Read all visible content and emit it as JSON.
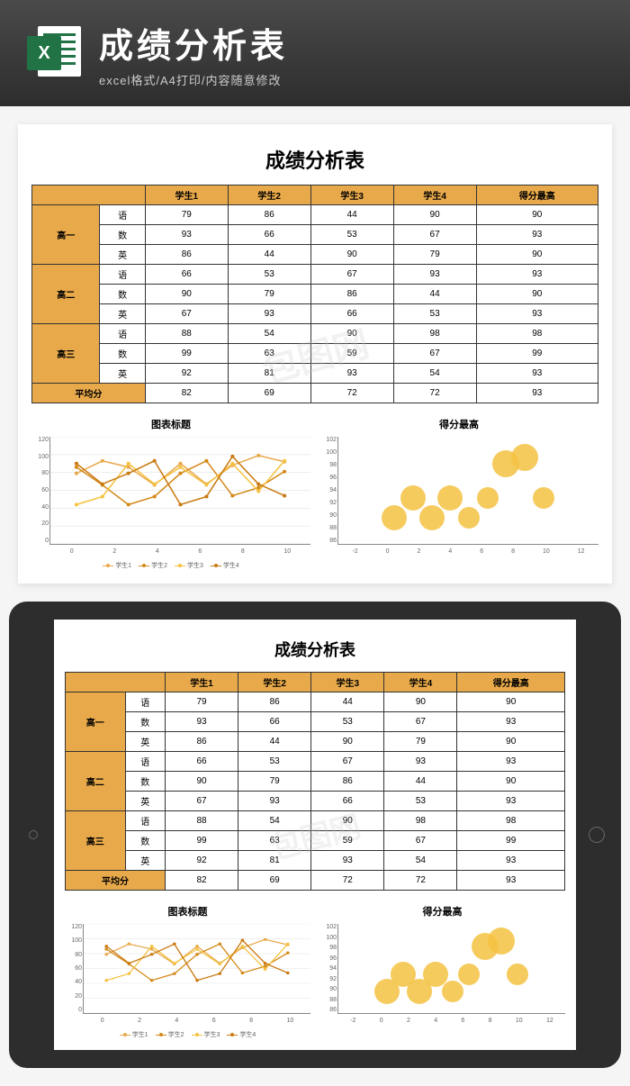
{
  "banner": {
    "title": "成绩分析表",
    "subtitle": "excel格式/A4打印/内容随意修改",
    "icon_letter": "X"
  },
  "doc": {
    "title": "成绩分析表",
    "headers": [
      "",
      "",
      "学生1",
      "学生2",
      "学生3",
      "学生4",
      "得分最高"
    ],
    "grades": [
      "高一",
      "高二",
      "高三"
    ],
    "subjects": [
      "语",
      "数",
      "英"
    ],
    "rows": [
      {
        "grade": 0,
        "subj": 0,
        "vals": [
          79,
          86,
          44,
          90,
          90
        ]
      },
      {
        "grade": 0,
        "subj": 1,
        "vals": [
          93,
          66,
          53,
          67,
          93
        ]
      },
      {
        "grade": 0,
        "subj": 2,
        "vals": [
          86,
          44,
          90,
          79,
          90
        ]
      },
      {
        "grade": 1,
        "subj": 0,
        "vals": [
          66,
          53,
          67,
          93,
          93
        ]
      },
      {
        "grade": 1,
        "subj": 1,
        "vals": [
          90,
          79,
          86,
          44,
          90
        ]
      },
      {
        "grade": 1,
        "subj": 2,
        "vals": [
          67,
          93,
          66,
          53,
          93
        ]
      },
      {
        "grade": 2,
        "subj": 0,
        "vals": [
          88,
          54,
          90,
          98,
          98
        ]
      },
      {
        "grade": 2,
        "subj": 1,
        "vals": [
          99,
          63,
          59,
          67,
          99
        ]
      },
      {
        "grade": 2,
        "subj": 2,
        "vals": [
          92,
          81,
          93,
          54,
          93
        ]
      }
    ],
    "avg_label": "平均分",
    "avg_vals": [
      82,
      69,
      72,
      72,
      93
    ]
  },
  "chart_data": [
    {
      "type": "line",
      "title": "图表标题",
      "x": [
        1,
        2,
        3,
        4,
        5,
        6,
        7,
        8,
        9
      ],
      "series": [
        {
          "name": "学生1",
          "color": "#e8a94a",
          "values": [
            79,
            93,
            86,
            66,
            90,
            67,
            88,
            99,
            92
          ]
        },
        {
          "name": "学生2",
          "color": "#d4891a",
          "values": [
            86,
            66,
            44,
            53,
            79,
            93,
            54,
            63,
            81
          ]
        },
        {
          "name": "学生3",
          "color": "#f5c242",
          "values": [
            44,
            53,
            90,
            67,
            86,
            66,
            90,
            59,
            93
          ]
        },
        {
          "name": "学生4",
          "color": "#c97a10",
          "values": [
            90,
            67,
            79,
            93,
            44,
            53,
            98,
            67,
            54
          ]
        }
      ],
      "ylim": [
        0,
        120
      ],
      "yticks": [
        0,
        20,
        40,
        60,
        80,
        100,
        120
      ],
      "xlim": [
        0,
        10
      ],
      "xticks": [
        0,
        2,
        4,
        6,
        8,
        10
      ]
    },
    {
      "type": "bubble",
      "title": "得分最高",
      "points": [
        {
          "x": 1,
          "y": 90,
          "r": 28
        },
        {
          "x": 2,
          "y": 93,
          "r": 28
        },
        {
          "x": 3,
          "y": 90,
          "r": 28
        },
        {
          "x": 4,
          "y": 93,
          "r": 28
        },
        {
          "x": 5,
          "y": 90,
          "r": 24
        },
        {
          "x": 6,
          "y": 93,
          "r": 24
        },
        {
          "x": 7,
          "y": 98,
          "r": 30
        },
        {
          "x": 8,
          "y": 99,
          "r": 30
        },
        {
          "x": 9,
          "y": 93,
          "r": 24
        }
      ],
      "ylim": [
        86,
        102
      ],
      "yticks": [
        86,
        88,
        90,
        92,
        94,
        96,
        98,
        100,
        102
      ],
      "xlim": [
        -2,
        12
      ],
      "xticks": [
        -2,
        0,
        2,
        4,
        6,
        8,
        10,
        12
      ]
    }
  ],
  "watermark": "包图网"
}
